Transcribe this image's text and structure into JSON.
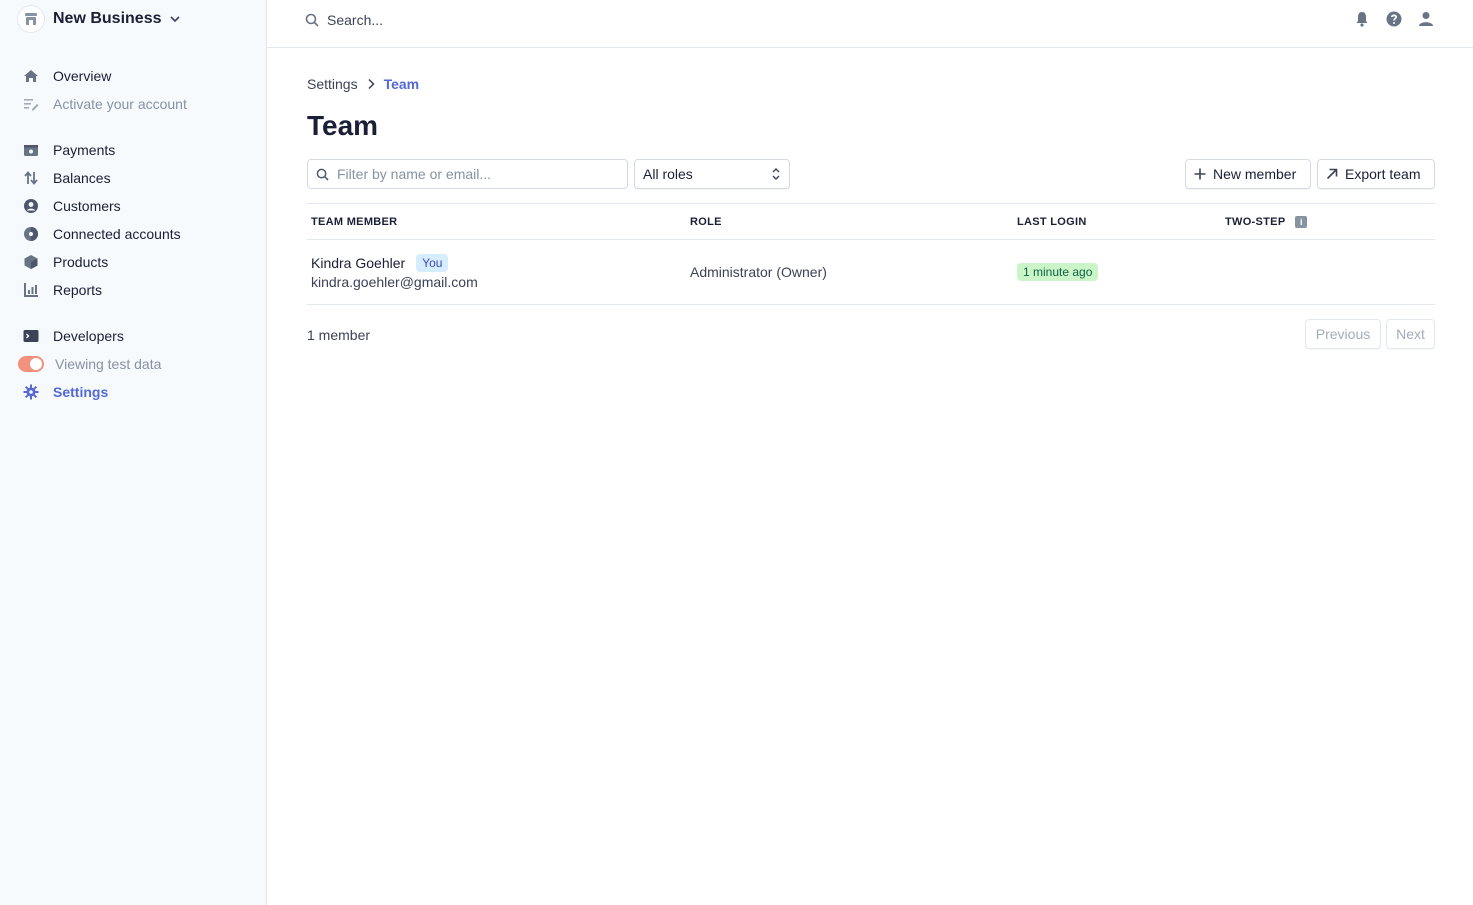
{
  "account": {
    "name": "New Business"
  },
  "search": {
    "placeholder": "Search..."
  },
  "sidebar": {
    "groups": [
      [
        {
          "label": "Overview",
          "icon": "home-icon"
        },
        {
          "label": "Activate your account",
          "icon": "edit-list-icon"
        }
      ],
      [
        {
          "label": "Payments",
          "icon": "wallet-icon"
        },
        {
          "label": "Balances",
          "icon": "arrows-icon"
        },
        {
          "label": "Customers",
          "icon": "customer-icon"
        },
        {
          "label": "Connected accounts",
          "icon": "globe-icon"
        },
        {
          "label": "Products",
          "icon": "box-icon"
        },
        {
          "label": "Reports",
          "icon": "report-icon"
        }
      ],
      [
        {
          "label": "Developers",
          "icon": "terminal-icon"
        },
        {
          "label": "Viewing test data",
          "icon": "toggle"
        },
        {
          "label": "Settings",
          "icon": "gear-icon"
        }
      ]
    ]
  },
  "breadcrumb": {
    "parent": "Settings",
    "current": "Team"
  },
  "page": {
    "title": "Team"
  },
  "filters": {
    "search_placeholder": "Filter by name or email...",
    "role_select": "All roles"
  },
  "actions": {
    "new_member": "New member",
    "export": "Export team"
  },
  "table": {
    "columns": [
      "TEAM MEMBER",
      "ROLE",
      "LAST LOGIN",
      "TWO-STEP"
    ],
    "rows": [
      {
        "name": "Kindra Goehler",
        "badge": "You",
        "email": "kindra.goehler@gmail.com",
        "role": "Administrator (Owner)",
        "last_login": "1 minute ago"
      }
    ]
  },
  "footer": {
    "count": "1 member",
    "previous": "Previous",
    "next": "Next"
  },
  "colors": {
    "accent": "#5469d4",
    "sidebar_bg": "#f7fafc",
    "toggle": "#f1917e",
    "success_bg": "#cbf4c9",
    "info_badge_bg": "#d6ecff"
  }
}
